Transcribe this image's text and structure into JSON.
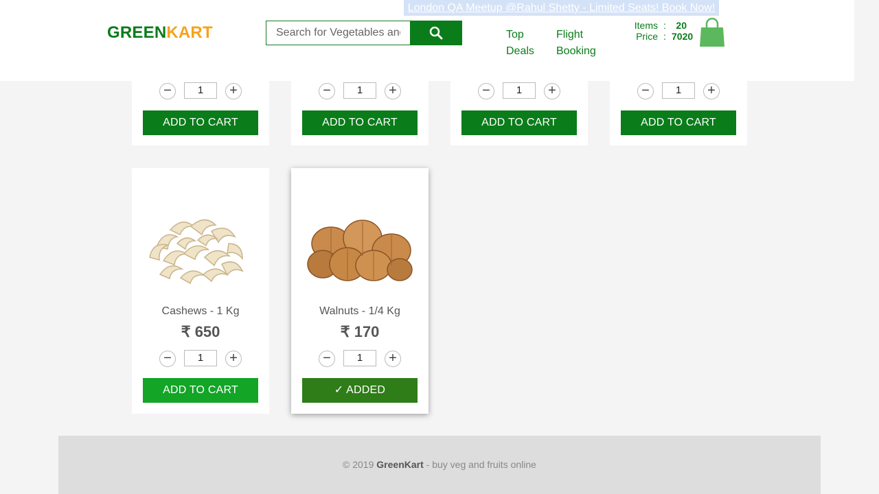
{
  "header": {
    "promo": "London QA Meetup @Rahul Shetty - Limited Seats! Book Now!",
    "brand_green": "GREEN",
    "brand_orange": "KART",
    "search_placeholder": "Search for Vegetables and Fruits",
    "nav": [
      {
        "label": "Top Deals"
      },
      {
        "label": "Flight Booking"
      }
    ],
    "cart": {
      "items_label": "Items",
      "items_value": "20",
      "price_label": "Price",
      "price_value": "7020",
      "separator": ":"
    }
  },
  "products_top_row": [
    {
      "qty": "1",
      "button": "ADD TO CART"
    },
    {
      "qty": "1",
      "button": "ADD TO CART"
    },
    {
      "qty": "1",
      "button": "ADD TO CART"
    },
    {
      "qty": "1",
      "button": "ADD TO CART"
    }
  ],
  "products": [
    {
      "name": "Cashews - 1 Kg",
      "price": "₹ 650",
      "qty": "1",
      "button": "ADD TO CART"
    },
    {
      "name": "Walnuts - 1/4 Kg",
      "price": "₹ 170",
      "qty": "1",
      "button": "✓ ADDED"
    }
  ],
  "stepper": {
    "minus": "−",
    "plus": "+"
  },
  "footer": {
    "prefix": "© 2019 ",
    "brand": "GreenKart",
    "suffix": " - buy veg and fruits online"
  },
  "colors": {
    "brand_green": "#0a7c1a",
    "brand_orange": "#f7a21b",
    "added_green": "#2e7d18"
  }
}
